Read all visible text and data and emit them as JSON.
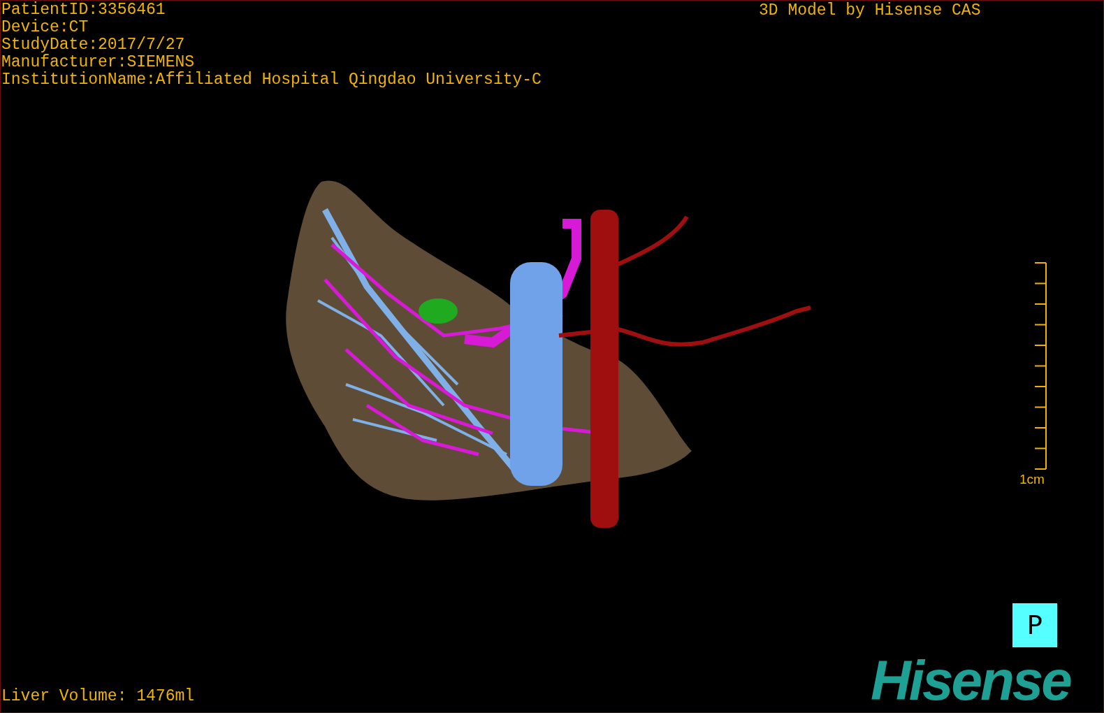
{
  "patient_info": [
    "PatientID:3356461",
    "Device:CT",
    "StudyDate:2017/7/27",
    "Manufacturer:SIEMENS",
    "InstitutionName:Affiliated Hospital Qingdao University-C"
  ],
  "credit": "3D Model by Hisense CAS",
  "scale_bar": {
    "label": "1cm"
  },
  "orientation_marker": "P",
  "logo": "Hisense",
  "liver_volume": "Liver Volume: 1476ml"
}
